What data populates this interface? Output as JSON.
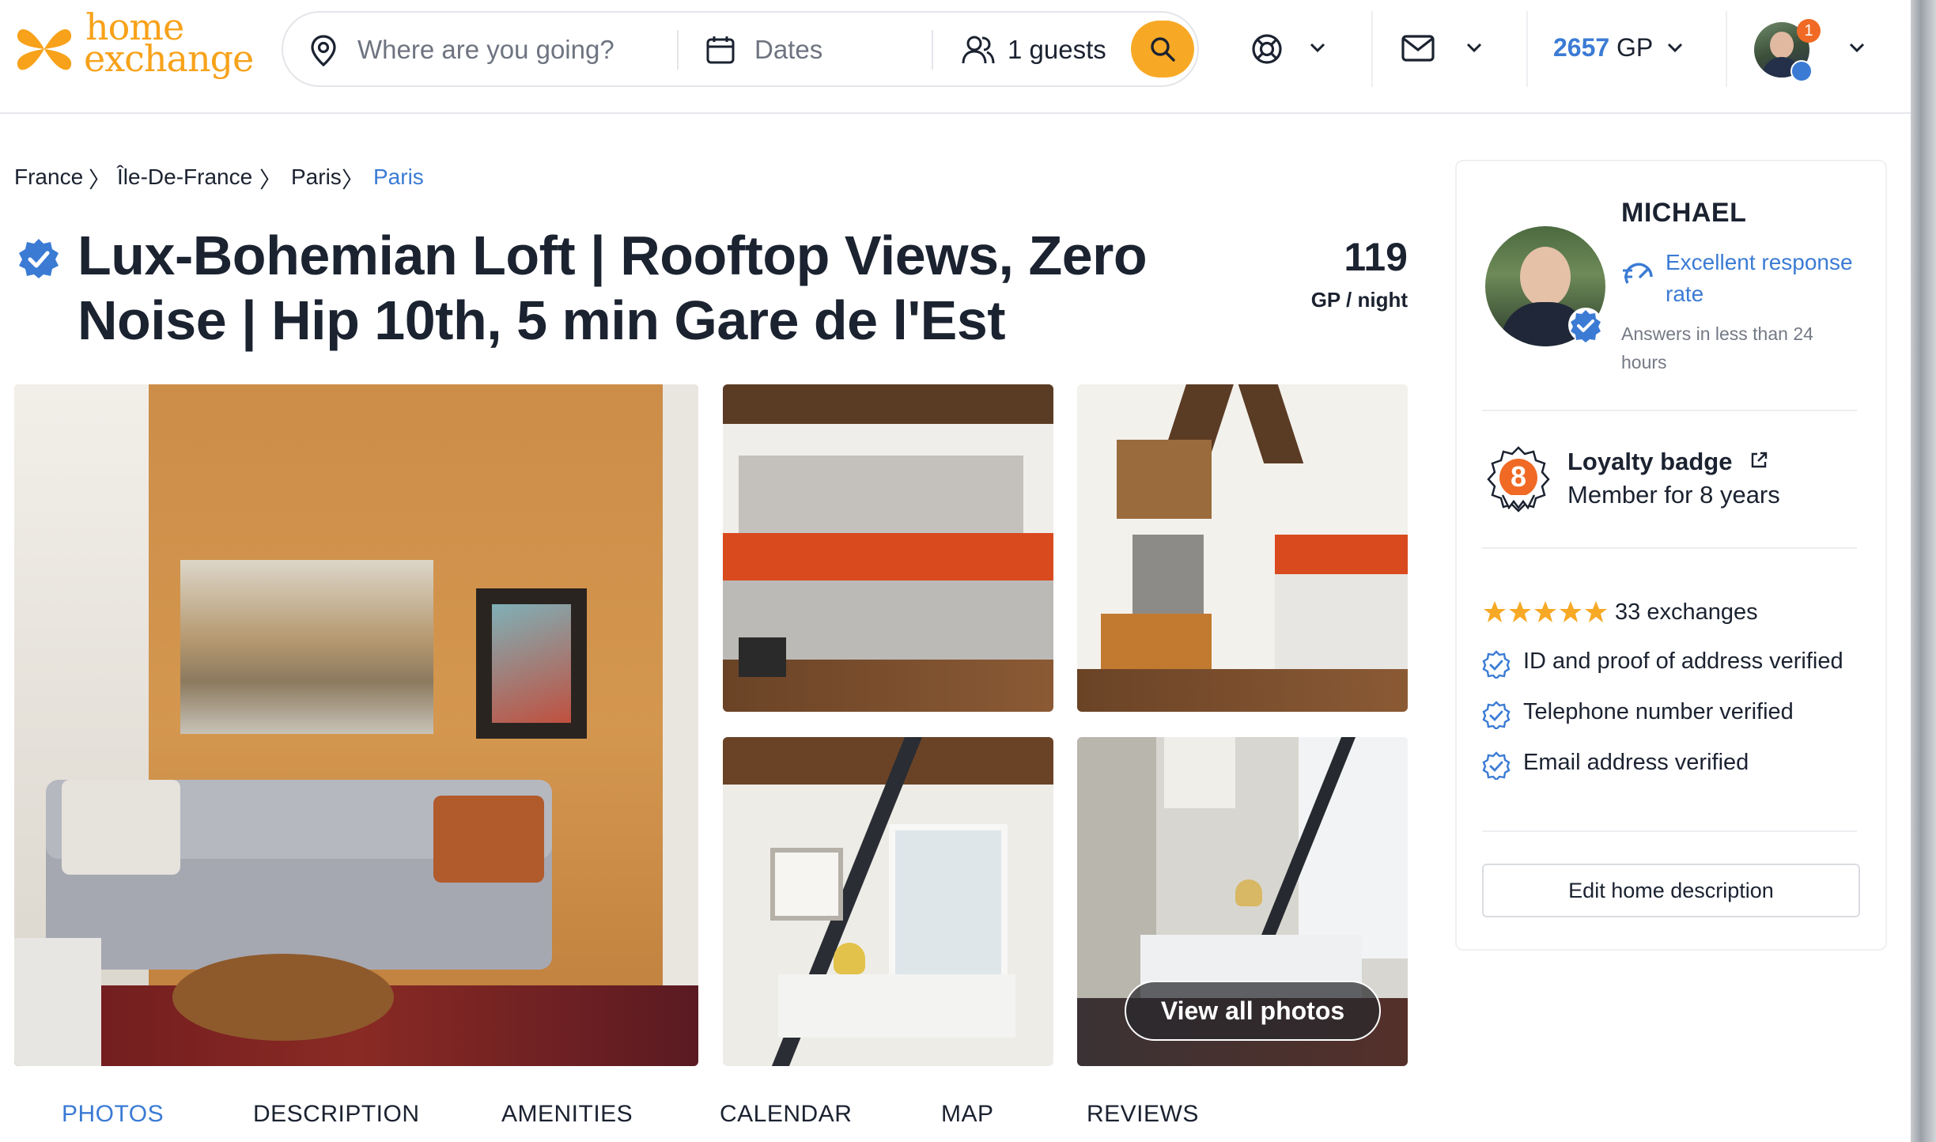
{
  "header": {
    "logo_line1": "home",
    "logo_line2": "exchange",
    "search": {
      "destination_placeholder": "Where are you going?",
      "dates_label": "Dates",
      "guests_label": "1 guests"
    },
    "gp_amount": "2657",
    "gp_unit": "GP",
    "notification_count": "1",
    "brand_color": "#f7a21a",
    "accent_color": "#3b7bd4"
  },
  "breadcrumb": [
    "France",
    "Île-De-France",
    "Paris",
    "Paris"
  ],
  "listing": {
    "title": "Lux-Bohemian Loft | Rooftop Views, Zero Noise | Hip 10th, 5 min Gare de l'Est",
    "price": "119",
    "price_unit": "GP / night",
    "view_all_photos": "View all photos"
  },
  "tabs": [
    "PHOTOS",
    "DESCRIPTION",
    "AMENITIES",
    "CALENDAR",
    "MAP",
    "REVIEWS"
  ],
  "host": {
    "name": "MICHAEL",
    "response_rate": "Excellent response rate",
    "response_time": "Answers in less than 24 hours",
    "loyalty_title": "Loyalty badge",
    "loyalty_years_badge": "8",
    "loyalty_subtitle": "Member for 8 years",
    "exchanges": "33 exchanges",
    "rating_stars": 5,
    "verifications": [
      "ID and proof of address verified",
      "Telephone number verified",
      "Email address verified"
    ],
    "edit_button": "Edit home description"
  }
}
